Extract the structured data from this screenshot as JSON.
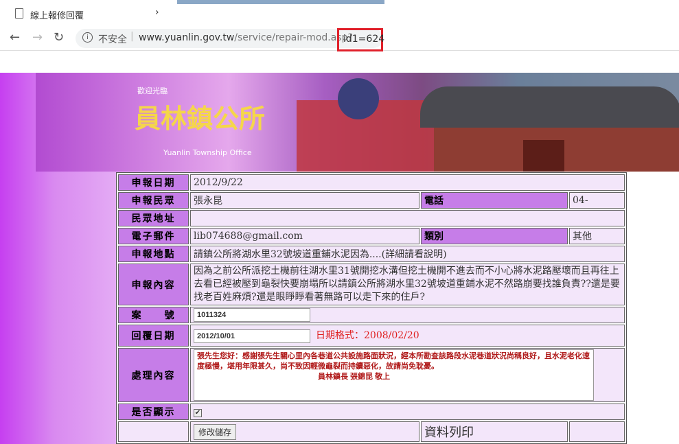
{
  "browser": {
    "tab_title": "線上報修回覆",
    "tab_close": "›",
    "insecure": "不安全",
    "url_prefix": "www.yuanlin.gov.tw",
    "url_path": "/service/repair-mod.asp?",
    "url_param": "id1=624"
  },
  "banner": {
    "welcome": "歡迎光臨",
    "name": "員林鎮公所",
    "en": "Yuanlin Township Office"
  },
  "form": {
    "date_label": "申報日期",
    "date": "2012/9/22",
    "person_label": "申報民眾",
    "person": "張永昆",
    "phone_label": "電話",
    "phone": "04-",
    "addr_label": "民眾地址",
    "addr": "",
    "email_label": "電子郵件",
    "email": "lib074688@gmail.com",
    "cat_label": "類別",
    "cat": "其他",
    "loc_label": "申報地點",
    "loc": "請鎮公所將湖水里32號坡道重鋪水泥因為....(詳細請看說明)",
    "content_label": "申報內容",
    "content": "因為之前公所派挖土機前往湖水里31號開挖水溝但挖土機開不進去而不小心將水泥路壓壞而且再往上去看已經被壓到龜裂快要崩塌所以請鎮公所將湖水里32號坡道重鋪水泥不然路崩要找誰負責??還是要找老百姓麻煩?還是眼睜睜看著無路可以走下來的住戶?",
    "case_label": "案　　號",
    "case": "1011324",
    "reply_label": "回覆日期",
    "reply": "2012/10/01",
    "fmt": "日期格式：2008/02/20",
    "handle_label": "處理內容",
    "handle": "張先生您好：感謝張先生關心里內各巷道公共設施路面狀況，經本所勘查該路段水泥巷道狀況尚稱良好，且水泥老化速度極慢，堪用年限甚久，尚不致因輕微龜裂而持續惡化，故請尚免耽憂。\n　　　　　　　　　　　　　　　　員林鎮長 張錦昆 敬上",
    "show_label": "是否顯示",
    "save": "修改儲存",
    "print": "資料列印"
  }
}
